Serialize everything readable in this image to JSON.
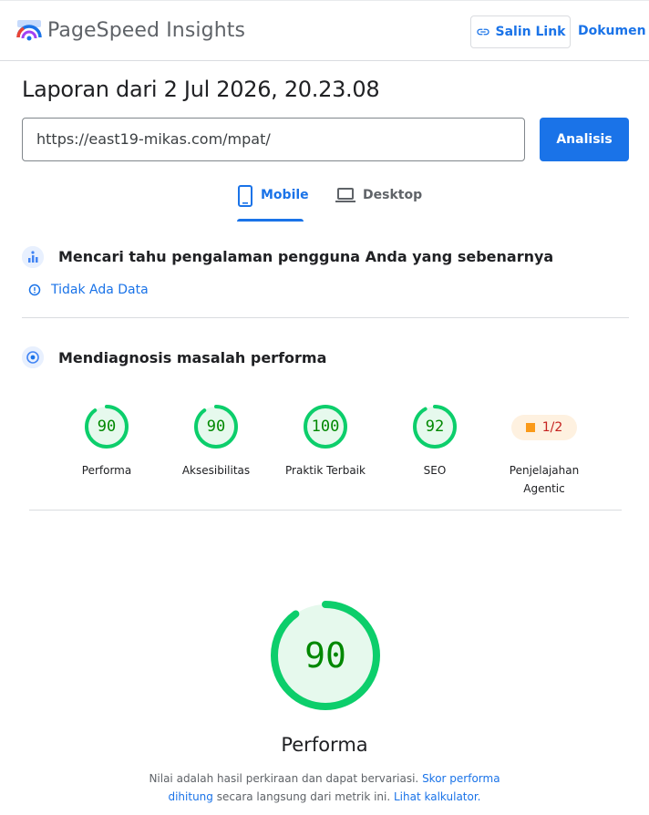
{
  "header": {
    "brand": "PageSpeed Insights",
    "copy_link_label": "Salin Link",
    "docs_label": "Dokumen"
  },
  "report": {
    "title": "Laporan dari 2 Jul 2026, 20.23.08"
  },
  "search": {
    "url_value": "https://east19-mikas.com/mpat/",
    "analyze_label": "Analisis"
  },
  "tabs": [
    {
      "label": "Mobile",
      "selected": true
    },
    {
      "label": "Desktop",
      "selected": false
    }
  ],
  "field_data": {
    "title": "Mencari tahu pengalaman pengguna Anda yang sebenarnya",
    "no_data_label": "Tidak Ada Data"
  },
  "diagnose": {
    "title": "Mendiagnosis masalah performa"
  },
  "scores": [
    {
      "value": "90",
      "label": "Performa",
      "fraction": 0.9
    },
    {
      "value": "90",
      "label": "Aksesibilitas",
      "fraction": 0.9
    },
    {
      "value": "100",
      "label": "Praktik Terbaik",
      "fraction": 1.0
    },
    {
      "value": "92",
      "label": "SEO",
      "fraction": 0.92
    }
  ],
  "agentic": {
    "value": "1/2",
    "label_line1": "Penjelajahan",
    "label_line2": "Agentic"
  },
  "performance": {
    "value": "90",
    "fraction": 0.9,
    "label": "Performa",
    "note_text1": "Nilai adalah hasil perkiraan dan dapat bervariasi. ",
    "note_link1": "Skor performa dihitung",
    "note_text2": " secara langsung dari metrik ini. ",
    "note_link2": "Lihat kalkulator."
  },
  "colors": {
    "accent": "#1a73e8",
    "pass": "#0cce6b",
    "pass_bg": "#e6f9ed",
    "pass_text": "#008800",
    "average": "#fa9a19"
  }
}
